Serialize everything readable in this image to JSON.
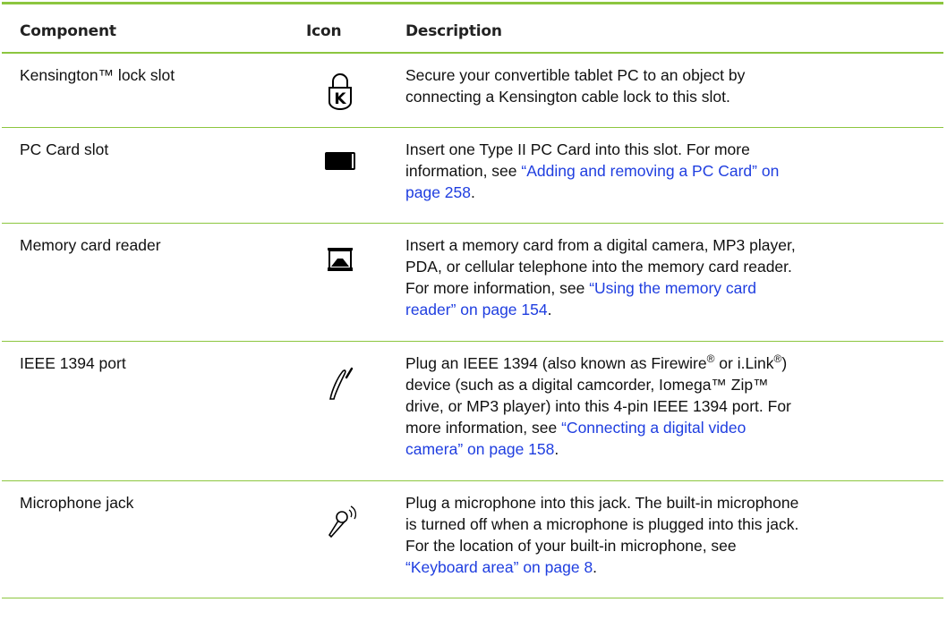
{
  "table": {
    "headers": {
      "component": "Component",
      "icon": "Icon",
      "description": "Description"
    },
    "rows": [
      {
        "component": "Kensington™ lock slot",
        "icon": "kensington-lock-icon",
        "desc_line1": "Secure your convertible tablet PC to an object by",
        "desc_line2": "connecting a Kensington cable lock to this slot."
      },
      {
        "component": "PC Card slot",
        "icon": "pc-card-icon",
        "desc_line1": "Insert one Type II PC Card into this slot. For more",
        "desc_line2_plain": "information, see ",
        "desc_line2_link": "“Adding and removing a PC Card” on",
        "desc_line3_link": "page 258",
        "desc_line3_plain": "."
      },
      {
        "component": "Memory card reader",
        "icon": "memory-card-reader-icon",
        "desc_line1": "Insert a memory card from a digital camera, MP3 player,",
        "desc_line2": "PDA, or cellular telephone into the memory card reader.",
        "desc_line3_plain": "For more information, see ",
        "desc_line3_link": "“Using the memory card",
        "desc_line4_link": "reader” on page 154",
        "desc_line4_plain": "."
      },
      {
        "component": "IEEE 1394 port",
        "icon": "ieee-1394-icon",
        "desc_line1_a": "Plug an IEEE 1394 (also known as Firewire",
        "desc_line1_sup1": "®",
        "desc_line1_b": " or i.Link",
        "desc_line1_sup2": "®",
        "desc_line1_c": ")",
        "desc_line2": "device (such as a digital camcorder, Iomega™ Zip™",
        "desc_line3": "drive, or MP3 player) into this 4-pin IEEE 1394 port. For",
        "desc_line4_plain": "more information, see ",
        "desc_line4_link": "“Connecting a digital video",
        "desc_line5_link": "camera” on page 158",
        "desc_line5_plain": "."
      },
      {
        "component": "Microphone jack",
        "icon": "microphone-icon",
        "desc_line1": "Plug a microphone into this jack. The built-in microphone",
        "desc_line2": "is turned off when a microphone is plugged into this jack.",
        "desc_line3": "For the location of your built-in microphone, see",
        "desc_line4_link": "“Keyboard area” on page 8",
        "desc_line4_plain": "."
      }
    ]
  },
  "colors": {
    "rule": "#8cc63f",
    "link": "#1f3ee0"
  }
}
